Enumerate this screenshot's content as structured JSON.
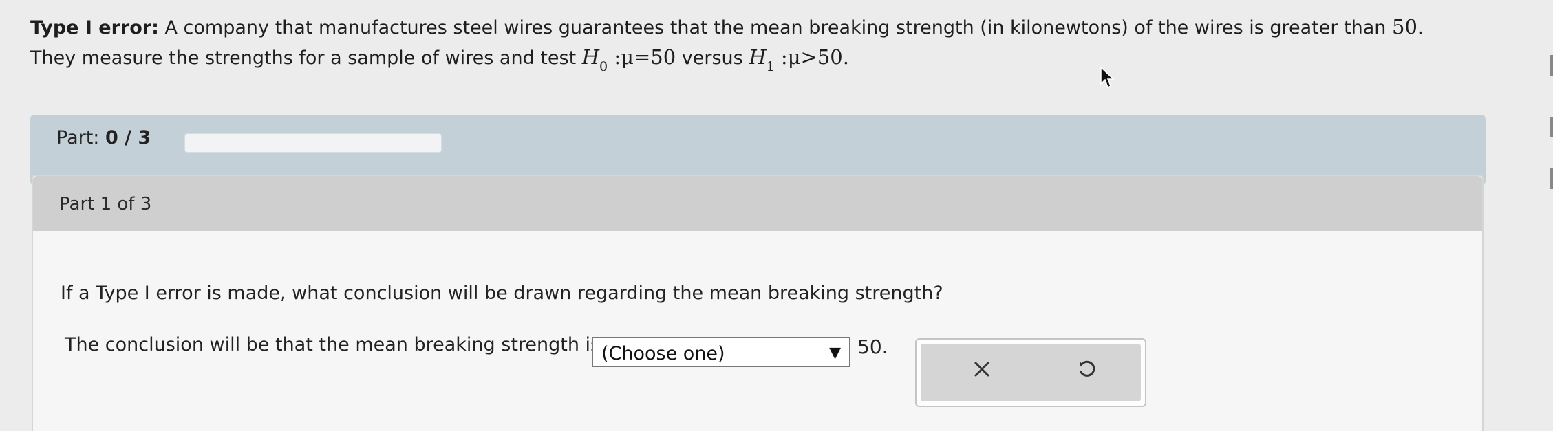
{
  "problem": {
    "lead": "Type I error:",
    "text_1": "A company that manufactures steel wires guarantees that the mean breaking strength (in kilonewtons) of the wires is greater than",
    "value_1": "50.",
    "text_2": "They measure the strengths for a sample of wires and test",
    "h0_var": "H",
    "h0_sub": "0",
    "h0_expr": ":μ=50",
    "versus": "versus",
    "h1_var": "H",
    "h1_sub": "1",
    "h1_expr": ":μ>50."
  },
  "progress": {
    "label": "Part:",
    "count": "0 / 3",
    "fraction": 0
  },
  "part": {
    "title": "Part 1 of 3",
    "question": "If a Type I error is made, what conclusion will be drawn regarding the mean breaking strength?",
    "answer_prefix": "The conclusion will be that the mean breaking strength is",
    "select_value": "(Choose one)",
    "answer_suffix": "50."
  },
  "actions": {
    "clear": "clear-icon",
    "undo": "undo-icon"
  }
}
